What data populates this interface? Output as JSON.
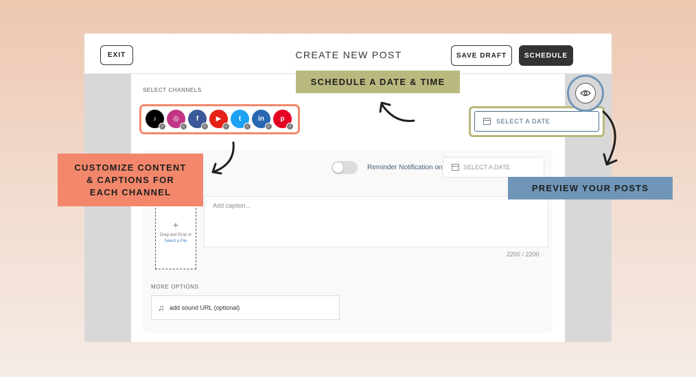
{
  "colors": {
    "accent_peach": "#f2876b",
    "accent_olive": "#b9b97f",
    "accent_blue": "#6f96b8",
    "dark_button": "#333333"
  },
  "header": {
    "exit_label": "EXIT",
    "title": "CREATE NEW POST",
    "save_draft_label": "SAVE DRAFT",
    "schedule_label": "SCHEDULE"
  },
  "channels": {
    "label": "SELECT CHANNELS",
    "items": [
      {
        "name": "TikTok",
        "glyph": "♪",
        "color": "#000000",
        "icon": "tiktok-icon"
      },
      {
        "name": "Instagram",
        "glyph": "◎",
        "color": "#c13584",
        "icon": "instagram-icon"
      },
      {
        "name": "Facebook",
        "glyph": "f",
        "color": "#3b5998",
        "icon": "facebook-icon"
      },
      {
        "name": "YouTube",
        "glyph": "▶",
        "color": "#e62117",
        "icon": "youtube-icon"
      },
      {
        "name": "Twitter",
        "glyph": "t",
        "color": "#1da1f2",
        "icon": "twitter-icon"
      },
      {
        "name": "LinkedIn",
        "glyph": "in",
        "color": "#2867b2",
        "icon": "linkedin-icon"
      },
      {
        "name": "Pinterest",
        "glyph": "p",
        "color": "#e60023",
        "icon": "pinterest-icon"
      }
    ]
  },
  "schedule_date": {
    "label": "SELECT A DATE"
  },
  "reminder": {
    "label": "Reminder Notification on",
    "date_placeholder": "SELECT A DATE"
  },
  "upload": {
    "plus": "+",
    "text": "Drag and Drop or",
    "link": "Select a File"
  },
  "caption": {
    "placeholder": "Add caption...",
    "char_count": "2200 / 2200"
  },
  "more_options": {
    "label": "MORE OPTIONS",
    "sound_placeholder": "add sound URL (optional)"
  },
  "annotations": {
    "schedule": "SCHEDULE A DATE & TIME",
    "customize_line1": "CUSTOMIZE CONTENT",
    "customize_line2": "& CAPTIONS FOR",
    "customize_line3": "EACH CHANNEL",
    "preview": "PREVIEW YOUR POSTS"
  }
}
